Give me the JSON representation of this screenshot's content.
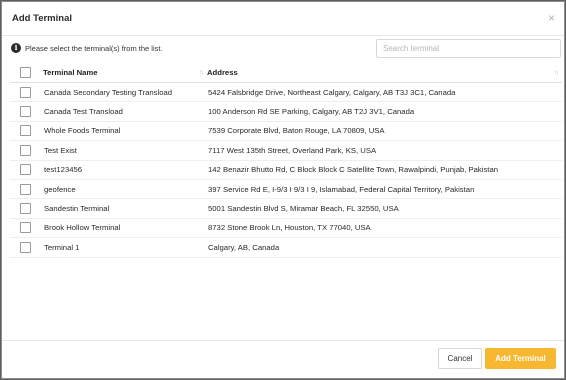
{
  "dialog": {
    "title": "Add Terminal",
    "close_glyph": "×",
    "info_text": "Please select the terminal(s) from the list.",
    "info_icon": "info-icon"
  },
  "search": {
    "placeholder": "Search terminal",
    "value": ""
  },
  "table": {
    "headers": {
      "name": "Terminal Name",
      "address": "Address",
      "sort_glyph": "↑↓"
    },
    "rows": [
      {
        "name": "Canada Secondary Testing Transload",
        "address": "5424 Falsbridge Drive, Northeast Calgary, Calgary, AB T3J 3C1, Canada",
        "checked": false
      },
      {
        "name": "Canada Test Transload",
        "address": "100 Anderson Rd SE Parking, Calgary, AB T2J 3V1, Canada",
        "checked": false
      },
      {
        "name": "Whole Foods Terminal",
        "address": "7539 Corporate Blvd, Baton Rouge, LA 70809, USA",
        "checked": false
      },
      {
        "name": "Test Exist",
        "address": "7117 West 135th Street, Overland Park, KS, USA",
        "checked": false
      },
      {
        "name": "test123456",
        "address": "142 Benazir Bhutto Rd, C Block Block C Satellite Town, Rawalpindi, Punjab, Pakistan",
        "checked": false
      },
      {
        "name": "geofence",
        "address": "397 Service Rd E, I-9/3 I 9/3 I 9, Islamabad, Federal Capital Territory, Pakistan",
        "checked": false
      },
      {
        "name": "Sandestin Terminal",
        "address": "5001 Sandestin Blvd S, Miramar Beach, FL 32550, USA",
        "checked": false
      },
      {
        "name": "Brook Hollow Terminal",
        "address": "8732 Stone Brook Ln, Houston, TX 77040, USA",
        "checked": false
      },
      {
        "name": "Terminal 1",
        "address": "Calgary, AB, Canada",
        "checked": false
      }
    ]
  },
  "footer": {
    "cancel_label": "Cancel",
    "add_label": "Add Terminal"
  },
  "colors": {
    "accent": "#f7b731",
    "overlay": "#5f5f5f"
  }
}
